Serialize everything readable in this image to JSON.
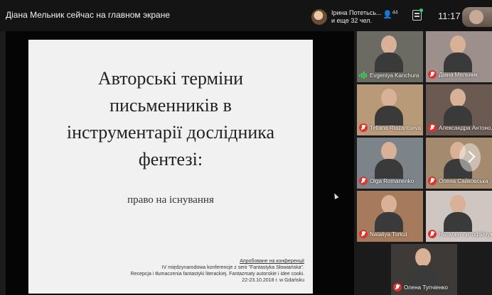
{
  "header": {
    "share_status": "Діана Мельник сейчас на главном экране",
    "host_name": "Ірина Потетьсь...",
    "host_more": "и еще 32 чел.",
    "participants_count": "44",
    "time": "11:17"
  },
  "slide": {
    "title_lines": [
      "Авторські терміни",
      "письменників в",
      "інструментарії дослідника",
      "фентезі:"
    ],
    "subtitle": "право на існування",
    "footer_lines": [
      "Апробоване на конференції",
      "IV międzynarodowa konferencje z serii \"Fantastyka Słowiańska\".",
      "Recepcja i tłumaczenia fantastyki literackiej.  Fantazmaty autorskie i idee cooki.",
      "22-23.10.2018 г. w Gdańsku"
    ]
  },
  "participants": [
    {
      "name": "Evgeniya Kanchura",
      "mic": "speaking",
      "bg": "#6c6b63"
    },
    {
      "name": "Діана Мельник",
      "mic": "muted",
      "bg": "#9c8f8c"
    },
    {
      "name": "Tetiana Riazantseva",
      "mic": "muted",
      "bg": "#b99a78"
    },
    {
      "name": "Александра Антоно...",
      "mic": "muted",
      "bg": "#6a5a52"
    },
    {
      "name": "Olga Romanenko",
      "mic": "muted",
      "bg": "#7d8489"
    },
    {
      "name": "Олена Сайковська",
      "mic": "muted",
      "bg": "#a48a6e"
    },
    {
      "name": "Nataliya Torkut",
      "mic": "muted",
      "bg": "#a67a5c"
    },
    {
      "name": "Наталья Антофійчук",
      "mic": "muted",
      "bg": "#cfc6c2"
    },
    {
      "name": "Олена Тупчіенко",
      "mic": "muted",
      "bg": "#3d3a38"
    }
  ]
}
